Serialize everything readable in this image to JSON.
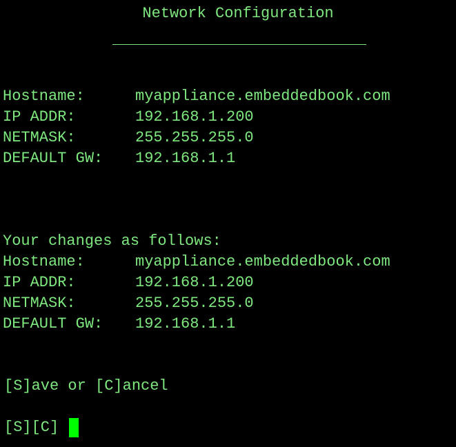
{
  "title": "Network Configuration",
  "current": {
    "hostname_label": "Hostname:",
    "hostname_value": "myappliance.embeddedbook.com",
    "ip_label": "IP ADDR:",
    "ip_value": "192.168.1.200",
    "netmask_label": "NETMASK:",
    "netmask_value": "255.255.255.0",
    "gateway_label": "DEFAULT GW:",
    "gateway_value": "192.168.1.1"
  },
  "changes": {
    "heading": "Your changes as follows:",
    "hostname_label": "Hostname:",
    "hostname_value": "myappliance.embeddedbook.com",
    "ip_label": "IP ADDR:",
    "ip_value": "192.168.1.200",
    "netmask_label": "NETMASK:",
    "netmask_value": "255.255.255.0",
    "gateway_label": "DEFAULT GW:",
    "gateway_value": "192.168.1.1"
  },
  "actions": {
    "instruction": "[S]ave or [C]ancel",
    "prompt": "[S][C]"
  },
  "colors": {
    "text": "#7ee87e",
    "background": "#000000",
    "cursor": "#00ff00"
  }
}
